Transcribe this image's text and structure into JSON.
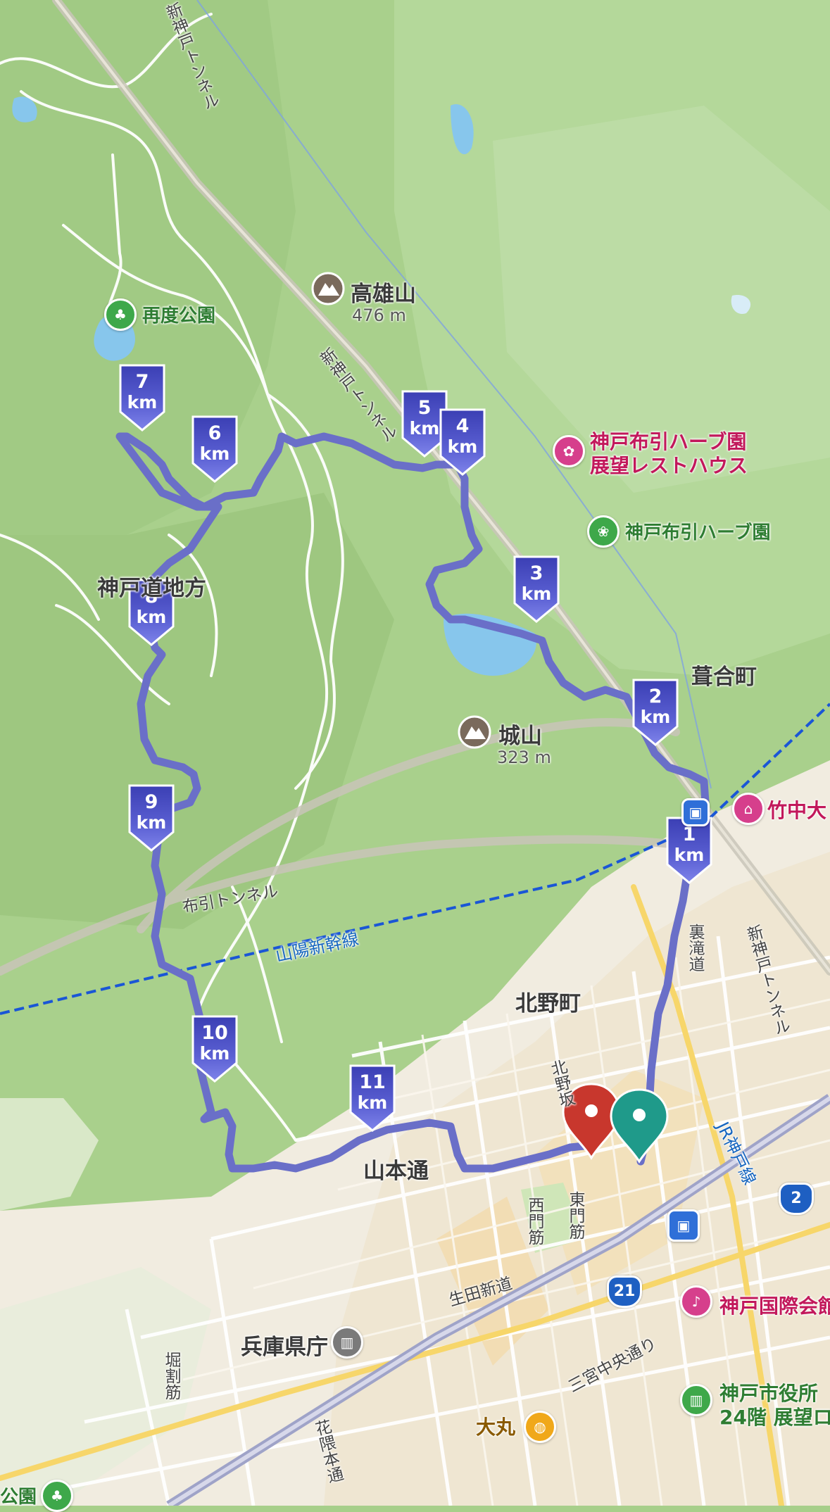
{
  "map": {
    "route_color": "#6a6fc8",
    "marker_color": "#4b50c4",
    "km_unit": "km",
    "km_markers": [
      {
        "n": "1"
      },
      {
        "n": "2"
      },
      {
        "n": "3"
      },
      {
        "n": "4"
      },
      {
        "n": "5"
      },
      {
        "n": "6"
      },
      {
        "n": "7"
      },
      {
        "n": "8"
      },
      {
        "n": "9"
      },
      {
        "n": "10"
      },
      {
        "n": "11"
      }
    ],
    "labels": {
      "saido_park": "再度公園",
      "takao_mountain": "高雄山",
      "takao_elevation": "476 m",
      "shiro_mountain": "城山",
      "shiro_elevation": "323 m",
      "nunobiki_herb_rest": "神戸布引ハーブ園",
      "nunobiki_herb_rest2": "展望レストハウス",
      "nunobiki_herb": "神戸布引ハーブ園",
      "fukiai": "葺合町",
      "takenaka": "竹中大",
      "kobe_michi": "神戸道地方",
      "nunobiki_tunnel": "布引トンネル",
      "sanyo_shinkansen": "山陽新幹線",
      "kitano_town": "北野町",
      "kitano_street": "北野坂",
      "yamamoto_street": "山本通",
      "urasando": "裏滝道",
      "shin_kobe_tunnel_top": "新神戸トンネル",
      "shin_kobe_tunnel_mid": "新神戸トンネル",
      "shin_kobe_tunnel_right": "新神戸トンネル",
      "nishimon": "西門筋",
      "higashimon": "東門筋",
      "ikuta_shindo": "生田新道",
      "hyogo_pref_office": "兵庫県庁",
      "horiwari": "堀割筋",
      "hanakuma": "花隈本通",
      "sannomiya_chuo": "三宮中央通り",
      "jr_kobe_line": "JR神戸線",
      "kobe_kokusai": "神戸国際会館",
      "kobe_city_hall": "神戸市役所",
      "kobe_city_hall2": "24階 展望ロ",
      "daimaru": "大丸",
      "park_bottom": "公園",
      "route_2": "2",
      "route_21": "21"
    }
  }
}
